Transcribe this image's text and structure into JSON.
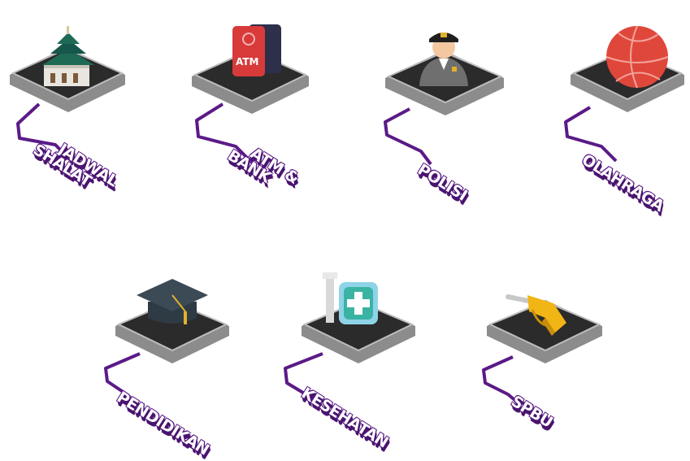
{
  "colors": {
    "purple": "#5b1a87",
    "platform_top": "#2b2b2b",
    "platform_side": "#8c8c8c",
    "label_shadow": "#4a1470"
  },
  "categories": [
    {
      "key": "jadwal-shalat",
      "label_lines": [
        "JADWAL",
        "SHALAT"
      ],
      "icon": "mosque-icon"
    },
    {
      "key": "atm-bank",
      "label_lines": [
        "ATM &",
        "BANK"
      ],
      "icon": "atm-card-icon",
      "icon_text": "ATM"
    },
    {
      "key": "polisi",
      "label_lines": [
        "POLISI"
      ],
      "icon": "police-officer-icon"
    },
    {
      "key": "olahraga",
      "label_lines": [
        "OLAHRAGA"
      ],
      "icon": "basketball-icon"
    },
    {
      "key": "pendidikan",
      "label_lines": [
        "PENDIDIKAN"
      ],
      "icon": "graduation-cap-icon"
    },
    {
      "key": "kesehatan",
      "label_lines": [
        "KESEHATAN"
      ],
      "icon": "medical-cross-icon"
    },
    {
      "key": "spbu",
      "label_lines": [
        "SPBU"
      ],
      "icon": "fuel-nozzle-icon"
    }
  ]
}
